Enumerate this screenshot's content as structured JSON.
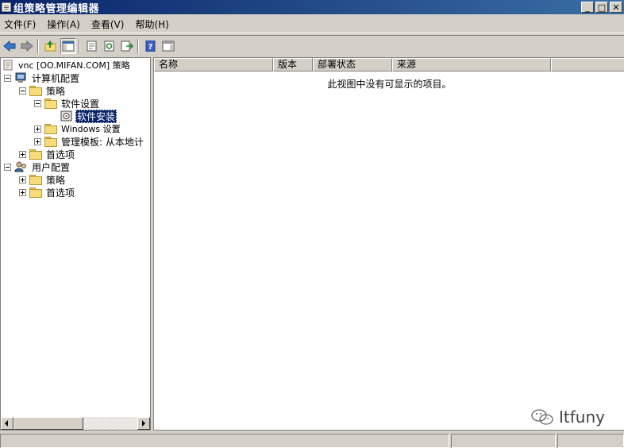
{
  "window": {
    "title": "组策略管理编辑器",
    "controls": {
      "minimize": "_",
      "maximize": "□",
      "close": "✕"
    }
  },
  "menu": {
    "items": [
      {
        "label": "文件(F)"
      },
      {
        "label": "操作(A)"
      },
      {
        "label": "查看(V)"
      },
      {
        "label": "帮助(H)"
      }
    ]
  },
  "toolbar": {
    "buttons": [
      {
        "icon": "back-arrow-icon",
        "color": "#3a78c8"
      },
      {
        "icon": "forward-arrow-icon",
        "color": "#808080"
      },
      {
        "icon": "up-one-level-icon"
      },
      {
        "icon": "show-hide-console-tree-icon"
      },
      {
        "icon": "properties-icon"
      },
      {
        "icon": "refresh-icon"
      },
      {
        "icon": "export-list-icon"
      },
      {
        "icon": "help-icon"
      },
      {
        "icon": "show-hide-action-pane-icon"
      }
    ]
  },
  "tree": {
    "root": {
      "label": "vnc [OO.MIFAN.COM] 策略"
    },
    "computer_config": {
      "label": "计算机配置"
    },
    "cc_policies": {
      "label": "策略"
    },
    "cc_software_settings": {
      "label": "软件设置"
    },
    "cc_software_install": {
      "label": "软件安装"
    },
    "cc_windows_settings": {
      "label": "Windows 设置"
    },
    "cc_admin_templates": {
      "label": "管理模板: 从本地计"
    },
    "cc_preferences": {
      "label": "首选项"
    },
    "user_config": {
      "label": "用户配置"
    },
    "uc_policies": {
      "label": "策略"
    },
    "uc_preferences": {
      "label": "首选项"
    }
  },
  "list": {
    "columns": [
      {
        "label": "名称"
      },
      {
        "label": "版本"
      },
      {
        "label": "部署状态"
      },
      {
        "label": "来源"
      }
    ],
    "empty_message": "此视图中没有可显示的项目。"
  },
  "watermark": {
    "text": "Itfuny"
  }
}
